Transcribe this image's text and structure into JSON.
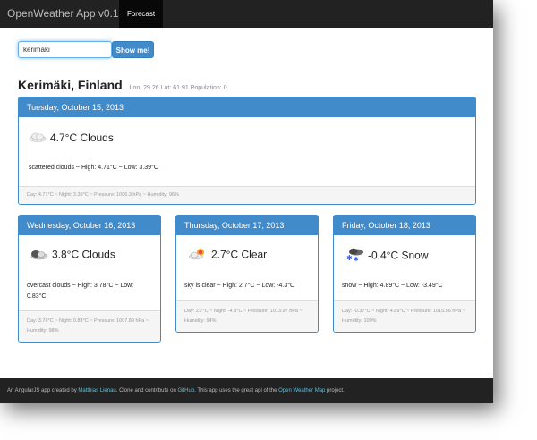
{
  "navbar": {
    "brand": "OpenWeather App v0.1.0",
    "tab": "Forecast"
  },
  "search": {
    "value": "kerimäki",
    "button_label": "Show me!"
  },
  "location": {
    "title": "Kerimäki, Finland",
    "meta": "Lon: 29.26 Lat: 61.91 Population: 0"
  },
  "today": {
    "date": "Tuesday, October 15, 2013",
    "icon": "cloud-icon",
    "summary": "4.7°C Clouds",
    "details": "scattered clouds ~  High: 4.71°C ~  Low: 3.39°C",
    "footer": "Day: 4.71°C ~  Night: 3.39°C ~  Pressure: 1006.3 hPa ~  Humidity: 96%"
  },
  "forecast": [
    {
      "date": "Wednesday, October 16, 2013",
      "icon": "dark-cloud-icon",
      "summary": "3.8°C Clouds",
      "details": "overcast clouds ~  High: 3.78°C ~  Low: 0.83°C",
      "footer": "Day: 3.78°C ~  Night: 0.83°C ~  Pressure: 1007.89 hPa ~  Humidity: 98%"
    },
    {
      "date": "Thursday, October 17, 2013",
      "icon": "sun-cloud-icon",
      "summary": "2.7°C Clear",
      "details": "sky is clear ~  High: 2.7°C ~  Low: -4.3°C",
      "footer": "Day: 2.7°C ~  Night: -4.3°C ~  Pressure: 1013.97 hPa ~  Humidity: 94%"
    },
    {
      "date": "Friday, October 18, 2013",
      "icon": "snow-cloud-icon",
      "summary": "-0.4°C Snow",
      "details": "snow ~  High: 4.89°C ~  Low: -3.49°C",
      "footer": "Day: -0.37°C ~  Night: 4.89°C ~  Pressure: 1015.56 hPa ~  Humidity: 100%"
    }
  ],
  "footer": {
    "t1": "An AngularJS app created by ",
    "author": "Matthias Lienau",
    "t2": ". Clone and contribute on ",
    "github": "GitHub",
    "t3": ". This app uses the great api of the ",
    "owm": "Open Weather Map",
    "t4": " project."
  },
  "colors": {
    "navbar": "#222222",
    "primary": "#428bca",
    "link": "#5bc0de"
  }
}
